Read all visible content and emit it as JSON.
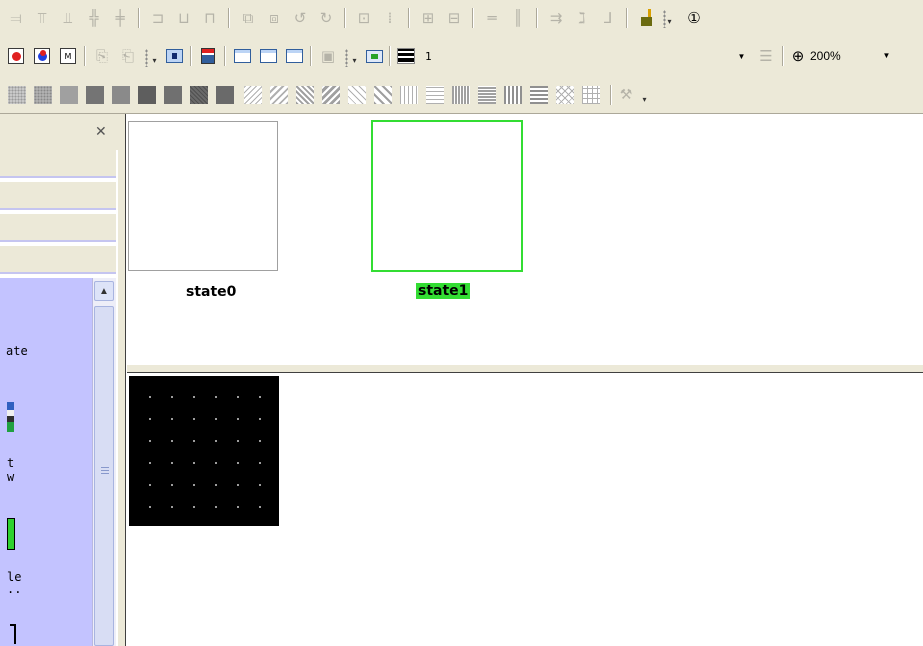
{
  "toolbar2": {
    "frame_value": "1",
    "zoom_value": "200%"
  },
  "state_view": {
    "states": [
      {
        "name": "state0"
      },
      {
        "name": "state1"
      }
    ],
    "selected_color": "#33dd33"
  },
  "left_panel": {
    "list_fragments": [
      "ate",
      "t",
      "w",
      "le",
      ".."
    ],
    "list_bg": "#c3c3ff"
  },
  "icons": {
    "close": "close-icon",
    "zoom": "magnifier-plus-icon",
    "scroll_up": "chevron-up-icon"
  }
}
